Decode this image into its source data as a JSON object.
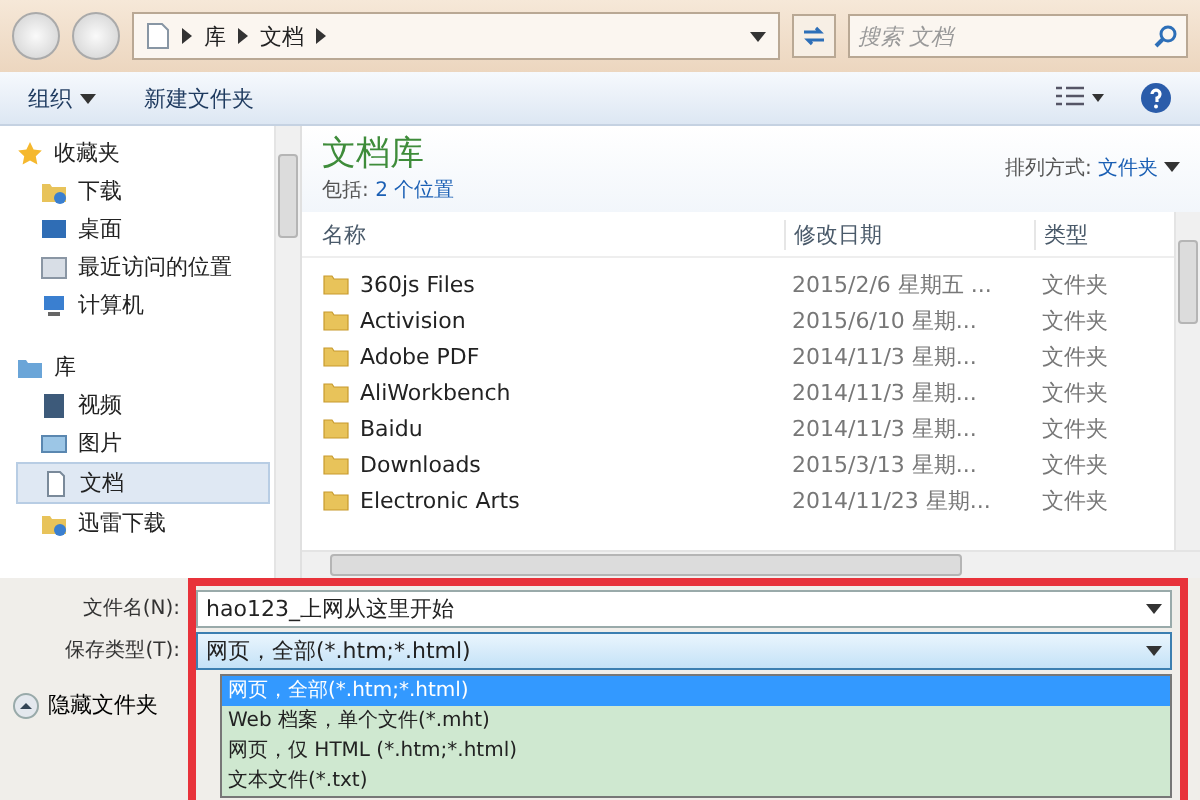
{
  "nav": {
    "breadcrumb": [
      "库",
      "文档"
    ],
    "search": {
      "placeholder": "搜索 文档"
    }
  },
  "toolbar": {
    "organize": "组织",
    "new_folder": "新建文件夹"
  },
  "sidebar": {
    "groups": [
      {
        "label": "收藏夹",
        "kind": "favorites",
        "items": [
          {
            "label": "下载",
            "kind": "download",
            "selected": false
          },
          {
            "label": "桌面",
            "kind": "desktop",
            "selected": false
          },
          {
            "label": "最近访问的位置",
            "kind": "recent",
            "selected": false
          },
          {
            "label": "计算机",
            "kind": "computer",
            "selected": false
          }
        ]
      },
      {
        "label": "库",
        "kind": "library",
        "items": [
          {
            "label": "视频",
            "kind": "video",
            "selected": false
          },
          {
            "label": "图片",
            "kind": "picture",
            "selected": false
          },
          {
            "label": "文档",
            "kind": "document",
            "selected": true
          },
          {
            "label": "迅雷下载",
            "kind": "download",
            "selected": false
          }
        ]
      }
    ]
  },
  "library": {
    "title": "文档库",
    "includes_label": "包括:",
    "includes_link": "2 个位置",
    "arrange_label": "排列方式:",
    "arrange_value": "文件夹"
  },
  "table": {
    "columns": [
      "名称",
      "修改日期",
      "类型"
    ],
    "rows": [
      [
        "360js Files",
        "2015/2/6 星期五 ...",
        "文件夹"
      ],
      [
        "Activision",
        "2015/6/10 星期...",
        "文件夹"
      ],
      [
        "Adobe PDF",
        "2014/11/3 星期...",
        "文件夹"
      ],
      [
        "AliWorkbench",
        "2014/11/3 星期...",
        "文件夹"
      ],
      [
        "Baidu",
        "2014/11/3 星期...",
        "文件夹"
      ],
      [
        "Downloads",
        "2015/3/13 星期...",
        "文件夹"
      ],
      [
        "Electronic Arts",
        "2014/11/23 星期...",
        "文件夹"
      ]
    ]
  },
  "form": {
    "filename_label": "文件名(N):",
    "filename_value": "hao123_上网从这里开始",
    "type_label": "保存类型(T):",
    "type_value": "网页，全部(*.htm;*.html)",
    "type_options": [
      {
        "label": "网页，全部(*.htm;*.html)",
        "selected": true
      },
      {
        "label": "Web 档案，单个文件(*.mht)",
        "selected": false
      },
      {
        "label": "网页，仅 HTML (*.htm;*.html)",
        "selected": false
      },
      {
        "label": "文本文件(*.txt)",
        "selected": false
      }
    ]
  },
  "hide_folders": "隐藏文件夹"
}
